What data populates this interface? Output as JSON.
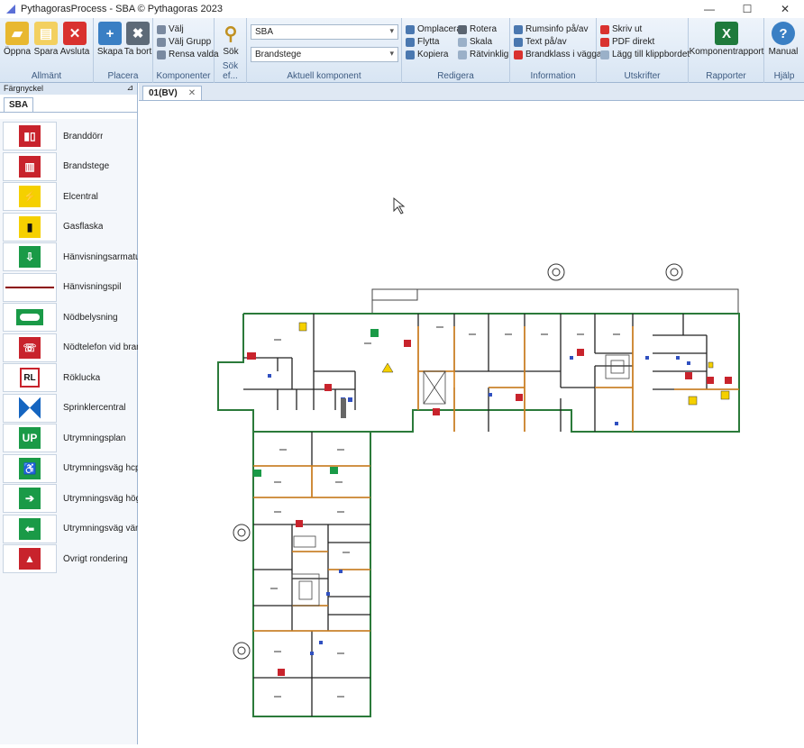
{
  "window": {
    "title": "PythagorasProcess - SBA © Pythagoras  2023",
    "minimize": "—",
    "maximize": "☐",
    "close": "✕"
  },
  "ribbon": {
    "groups": {
      "allmant": "Allmänt",
      "placera": "Placera",
      "komponenter": "Komponenter",
      "sok": "Sök ef...",
      "aktuell": "Aktuell komponent",
      "redigera": "Redigera",
      "information": "Information",
      "utskrifter": "Utskrifter",
      "rapporter": "Rapporter",
      "hjalp": "Hjälp"
    },
    "buttons": {
      "oppna": "Öppna",
      "spara": "Spara",
      "avsluta": "Avsluta",
      "skapa": "Skapa",
      "tabort": "Ta bort",
      "valj": "Välj",
      "valjgrupp": "Välj Grupp",
      "rensa": "Rensa valda",
      "sok": "Sök",
      "omplacera": "Omplacera",
      "rotera": "Rotera",
      "flytta": "Flytta",
      "skala": "Skala",
      "kopiera": "Kopiera",
      "ratvinklig": "Rätvinklig",
      "rumsinfo": "Rumsinfo på/av",
      "text": "Text på/av",
      "brandklass": "Brandklass i väggar",
      "skrivut": "Skriv ut",
      "pdf": "PDF direkt",
      "klipp": "Lägg till klippbordet",
      "komponentrapport": "Komponentrapport",
      "manual": "Manual"
    },
    "combo1": "SBA",
    "combo2": "Brandstege"
  },
  "leftpanel": {
    "header": "Färgnyckel",
    "pin": "▐",
    "tab": "SBA",
    "items": [
      "Branddorr_placeholder"
    ]
  },
  "legend": [
    {
      "label": "Branddörr",
      "icon": "fire-door-icon",
      "color": "#c8232c"
    },
    {
      "label": "Brandstege",
      "icon": "fire-ladder-icon",
      "color": "#c8232c"
    },
    {
      "label": "Elcentral",
      "icon": "electric-warning-icon",
      "color": "#f5d000"
    },
    {
      "label": "Gasflaska",
      "icon": "gas-cylinder-icon",
      "color": "#f5d000"
    },
    {
      "label": "Hänvisningsarmatur",
      "icon": "exit-sign-icon",
      "color": "#1a9a47"
    },
    {
      "label": "Hänvisningspil",
      "icon": "guidance-arrow-icon",
      "color": "#8b0000"
    },
    {
      "label": "Nödbelysning",
      "icon": "emergency-light-icon",
      "color": "#1a9a47"
    },
    {
      "label": "Nödtelefon vid brand",
      "icon": "emergency-phone-icon",
      "color": "#c8232c"
    },
    {
      "label": "Röklucka",
      "icon": "smoke-hatch-icon",
      "color": "#c8232c"
    },
    {
      "label": "Sprinklercentral",
      "icon": "sprinkler-icon",
      "color": "#1565c0"
    },
    {
      "label": "Utrymningsplan",
      "icon": "evacuation-plan-icon",
      "color": "#1a9a47"
    },
    {
      "label": "Utrymningsväg hcp",
      "icon": "exit-hcp-icon",
      "color": "#1a9a47"
    },
    {
      "label": "Utrymningsväg höger",
      "icon": "exit-right-icon",
      "color": "#1a9a47"
    },
    {
      "label": "Utrymningsväg vänster",
      "icon": "exit-left-icon",
      "color": "#1a9a47"
    },
    {
      "label": "Övrigt rondering",
      "icon": "patrol-icon",
      "color": "#c8232c"
    }
  ],
  "doc": {
    "tab": "01(BV)",
    "close": "✕"
  }
}
